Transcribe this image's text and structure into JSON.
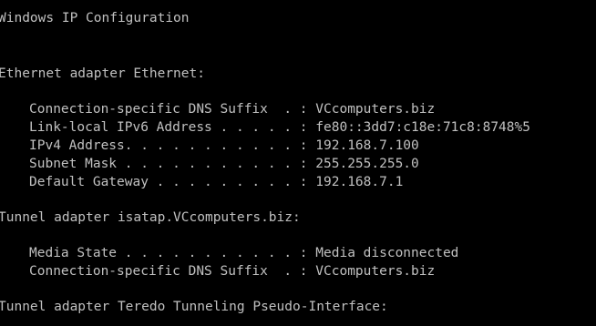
{
  "console": {
    "title_line": "Windows IP Configuration",
    "sections": [
      {
        "header": "Ethernet adapter Ethernet:",
        "entries": [
          "Connection-specific DNS Suffix  . : VCcomputers.biz",
          "Link-local IPv6 Address . . . . . : fe80::3dd7:c18e:71c8:8748%5",
          "IPv4 Address. . . . . . . . . . . : 192.168.7.100",
          "Subnet Mask . . . . . . . . . . . : 255.255.255.0",
          "Default Gateway . . . . . . . . . : 192.168.7.1"
        ]
      },
      {
        "header": "Tunnel adapter isatap.VCcomputers.biz:",
        "entries": [
          "Media State . . . . . . . . . . . : Media disconnected",
          "Connection-specific DNS Suffix  . : VCcomputers.biz"
        ]
      },
      {
        "header": "Tunnel adapter Teredo Tunneling Pseudo-Interface:",
        "entries": []
      }
    ],
    "colors": {
      "background": "#000000",
      "text": "#c0c0c0"
    }
  }
}
